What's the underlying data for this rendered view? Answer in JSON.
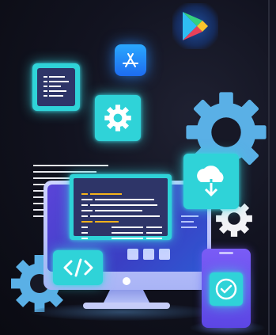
{
  "colors": {
    "background": "#0f1019",
    "teal_accent": "#2fd3d8",
    "blue_accent": "#1d8cff",
    "gear_blue": "#5ab0e6",
    "monitor_screen": "#3b3fc4",
    "phone_body": "#6a4cf0"
  },
  "icons": {
    "play_store": "play-store-icon",
    "app_store": "app-store-icon",
    "document": "document-code-icon",
    "settings": "gear-icon",
    "cloud_download": "cloud-download-icon",
    "code": "code-brackets-icon",
    "verified": "check-badge-icon"
  }
}
